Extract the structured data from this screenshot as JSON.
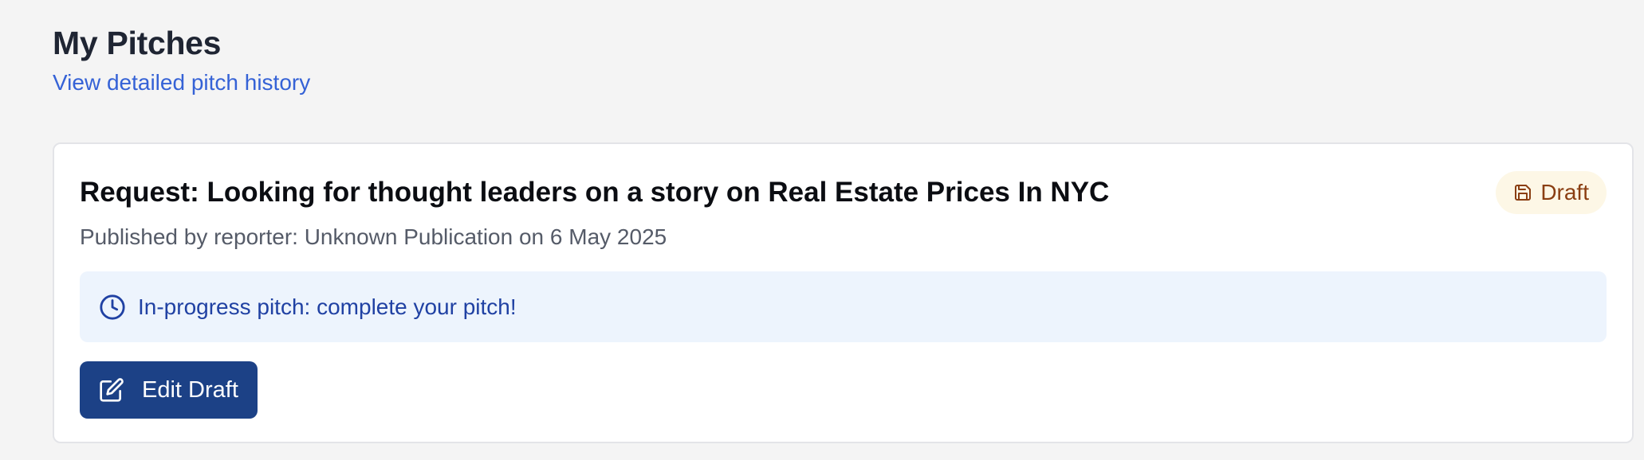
{
  "header": {
    "title": "My Pitches",
    "history_link": "View detailed pitch history"
  },
  "pitch_card": {
    "title": "Request: Looking for thought leaders on a story on Real Estate Prices In NYC",
    "subtitle": "Published by reporter: Unknown Publication on 6 May 2025",
    "status": {
      "label": "Draft",
      "icon": "save-icon",
      "color": "#8a3e12",
      "background": "#fdf7e6"
    },
    "notice": {
      "icon": "clock-icon",
      "text": "In-progress pitch: complete your pitch!",
      "color": "#2041a3",
      "background": "#edf4fd"
    },
    "action": {
      "icon": "edit-icon",
      "label": "Edit Draft",
      "background": "#1c4186"
    }
  },
  "colors": {
    "page_background": "#f4f4f4",
    "link": "#3562d6"
  }
}
